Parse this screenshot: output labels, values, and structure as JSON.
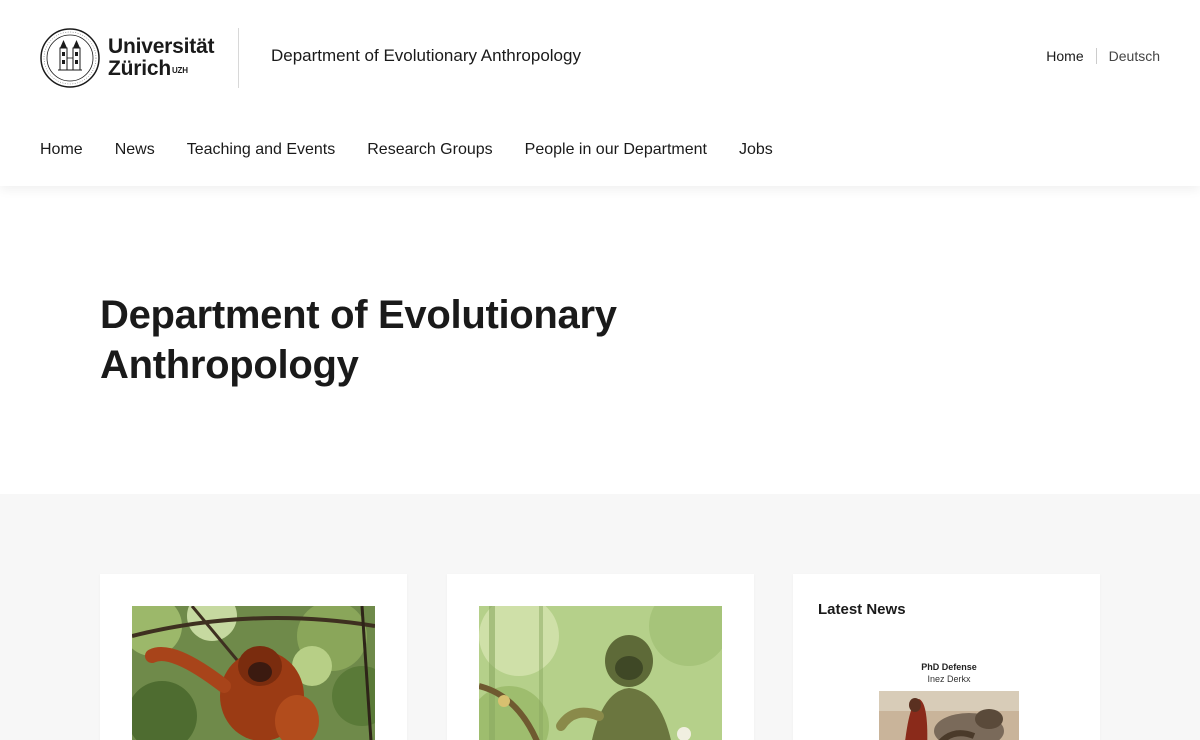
{
  "header": {
    "logo_line1": "Universität",
    "logo_line2": "Zürich",
    "logo_sup": "UZH",
    "department": "Department of Evolutionary Anthropology",
    "meta_nav": {
      "home": "Home",
      "language": "Deutsch"
    }
  },
  "nav": {
    "items": [
      {
        "label": "Home"
      },
      {
        "label": "News"
      },
      {
        "label": "Teaching and Events"
      },
      {
        "label": "Research Groups"
      },
      {
        "label": "People in our Department"
      },
      {
        "label": "Jobs"
      }
    ]
  },
  "hero": {
    "title_line1": "Department of Evolutionary",
    "title_line2": "Anthropology"
  },
  "cards": {
    "latest_news": {
      "heading": "Latest News",
      "item_title": "PhD Defense",
      "item_subtitle": "Inez Derkx"
    }
  },
  "icons": {
    "logo": "uzh-seal-icon",
    "card1": "orangutan-photo",
    "card2": "hominin-illustration",
    "news": "news-thumbnail-photo"
  }
}
